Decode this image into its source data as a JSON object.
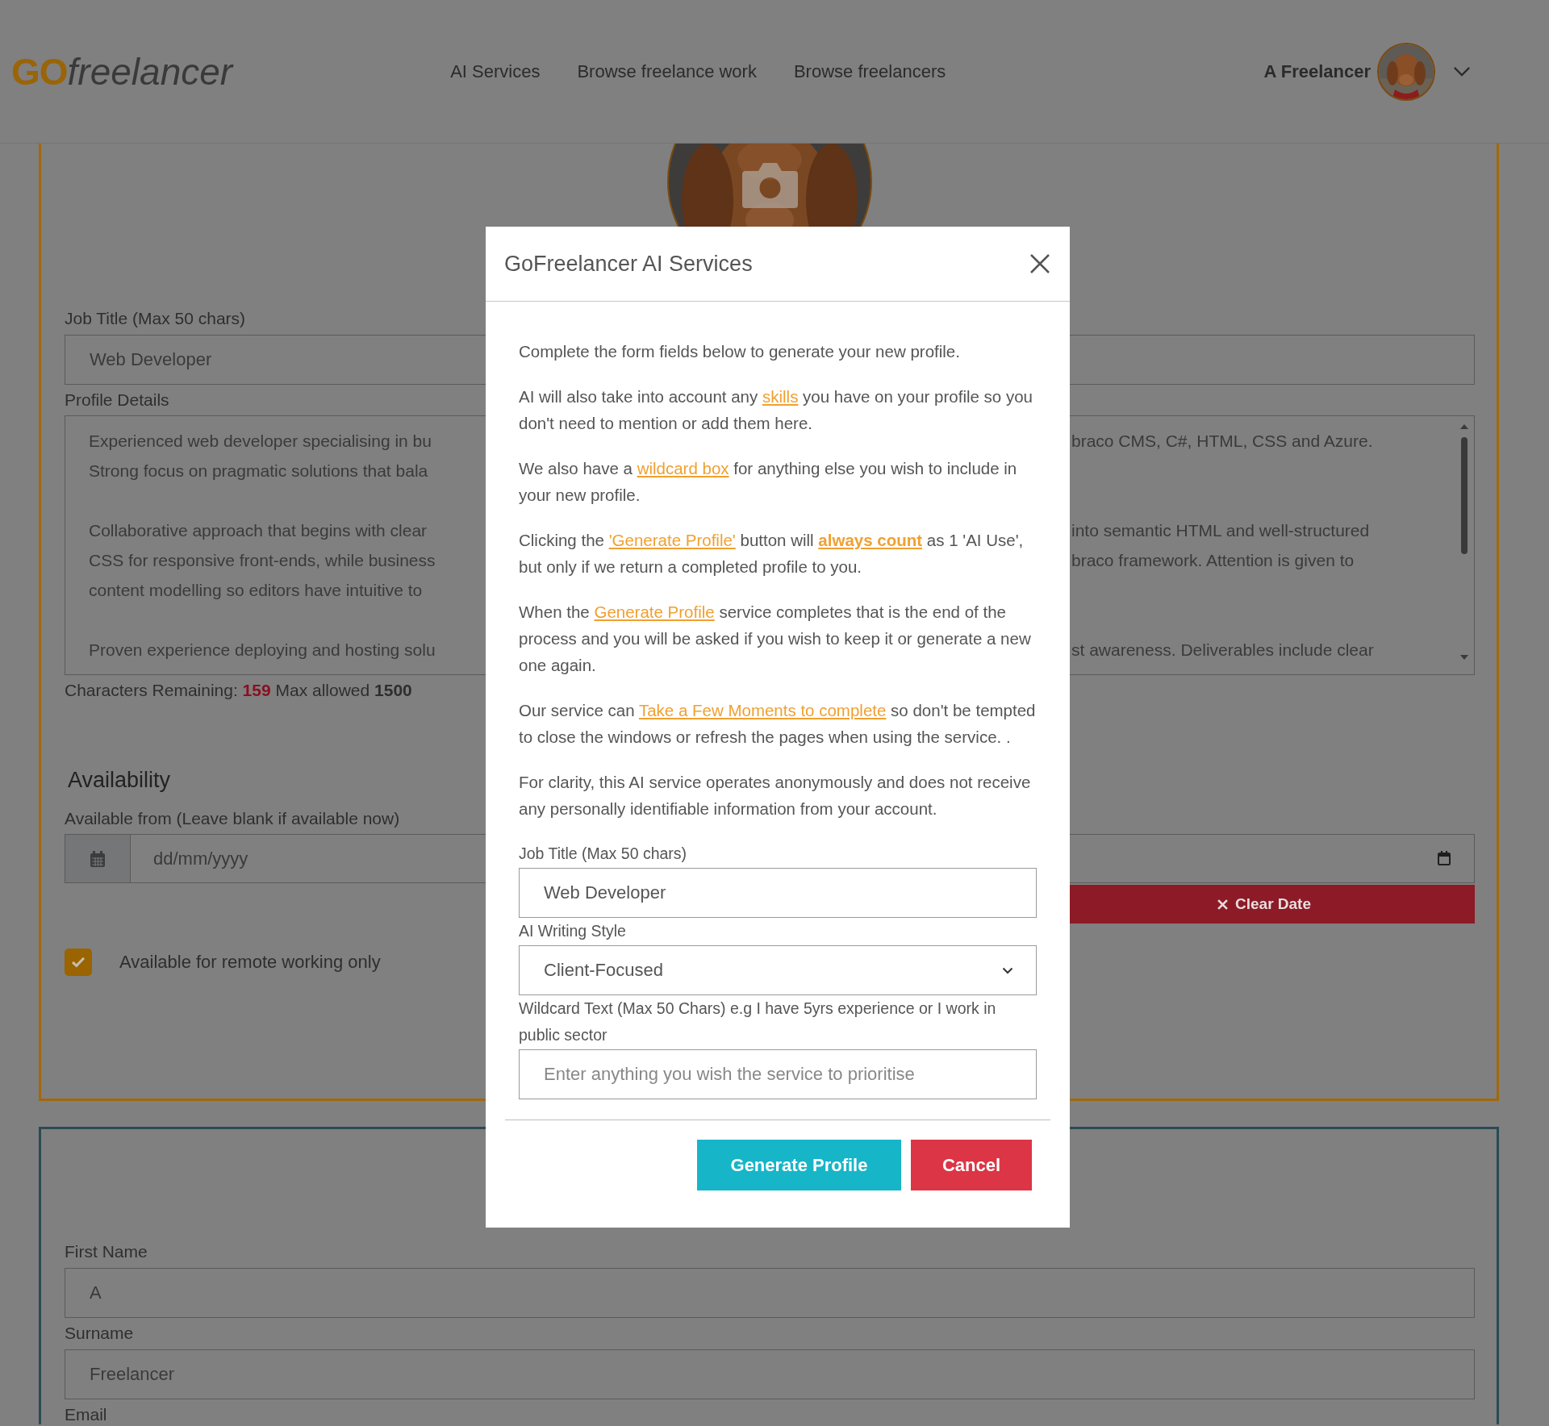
{
  "header": {
    "logo": {
      "strong": "GO",
      "rest": "freelancer"
    },
    "nav": [
      "AI Services",
      "Browse freelance work",
      "Browse freelancers"
    ],
    "user": {
      "name": "A Freelancer"
    }
  },
  "profile": {
    "job_title": {
      "label": "Job Title (Max 50 chars)",
      "value": "Web Developer"
    },
    "details": {
      "label": "Profile Details",
      "paragraphs": [
        {
          "lines": [
            {
              "left": "Experienced web developer specialising in bu",
              "right": "braco CMS, C#, HTML, CSS and Azure."
            },
            {
              "left": "Strong focus on pragmatic solutions that bala"
            }
          ]
        },
        {
          "lines": [
            {
              "left": "Collaborative approach that begins with clear",
              "right": "into semantic HTML and well-structured"
            },
            {
              "left": "CSS for responsive front-ends, while business",
              "right": "braco framework. Attention is given to"
            },
            {
              "left": "content modelling so editors have intuitive to"
            }
          ]
        },
        {
          "lines": [
            {
              "left": "Proven experience deploying and hosting solu",
              "right": "st awareness. Deliverables include clear"
            }
          ]
        }
      ]
    },
    "char_count": {
      "label": "Characters Remaining:",
      "remaining": "159",
      "max_label": "Max allowed",
      "max": "1500"
    },
    "availability": {
      "heading": "Availability",
      "date_label": "Available from (Leave blank if available now)",
      "date_placeholder": "dd/mm/yyyy",
      "clear_button": "Clear Date",
      "remote": {
        "label": "Available for remote working only",
        "checked": true
      }
    }
  },
  "personal": {
    "fields": [
      {
        "label": "First Name",
        "value": "A"
      },
      {
        "label": "Surname",
        "value": "Freelancer"
      }
    ],
    "email_label": "Email"
  },
  "modal": {
    "title": "GoFreelancer AI Services",
    "paragraphs": [
      [
        {
          "kind": "text",
          "text": "Complete the form fields below to generate your new profile."
        }
      ],
      [
        {
          "kind": "text",
          "text": "AI will also take into account any "
        },
        {
          "kind": "link",
          "text": "skills"
        },
        {
          "kind": "text",
          "text": " you have on your profile so you don't need to mention or add them here."
        }
      ],
      [
        {
          "kind": "text",
          "text": "We also have a "
        },
        {
          "kind": "link",
          "text": "wildcard box"
        },
        {
          "kind": "text",
          "text": " for anything else you wish to include in your new profile."
        }
      ],
      [
        {
          "kind": "text",
          "text": "Clicking the "
        },
        {
          "kind": "link",
          "text": "'Generate Profile'"
        },
        {
          "kind": "text",
          "text": " button will "
        },
        {
          "kind": "strong_link",
          "text": "always count"
        },
        {
          "kind": "text",
          "text": " as 1 'AI Use', but only if we return a completed profile to you."
        }
      ],
      [
        {
          "kind": "text",
          "text": "When the "
        },
        {
          "kind": "link",
          "text": "Generate Profile"
        },
        {
          "kind": "text",
          "text": " service completes that is the end of the process and you will be asked if you wish to keep it or generate a new one again."
        }
      ],
      [
        {
          "kind": "text",
          "text": "Our service can "
        },
        {
          "kind": "link",
          "text": "Take a Few Moments to complete"
        },
        {
          "kind": "text",
          "text": " so don't be tempted to close the windows or refresh the pages when using the service. ."
        }
      ],
      [
        {
          "kind": "text",
          "text": "For clarity, this AI service operates anonymously and does not receive any personally identifiable information from your account."
        }
      ]
    ],
    "fields": [
      {
        "kind": "text",
        "label": "Job Title (Max 50 chars)",
        "value": "Web Developer"
      },
      {
        "kind": "select",
        "label": "AI Writing Style",
        "value": "Client-Focused"
      },
      {
        "kind": "text",
        "label": "Wildcard Text (Max 50 Chars) e.g I have 5yrs experience or I work in public sector",
        "placeholder": "Enter anything you wish the service to prioritise"
      }
    ],
    "buttons": [
      {
        "kind": "primary",
        "label": "Generate Profile"
      },
      {
        "kind": "danger",
        "label": "Cancel"
      }
    ]
  }
}
